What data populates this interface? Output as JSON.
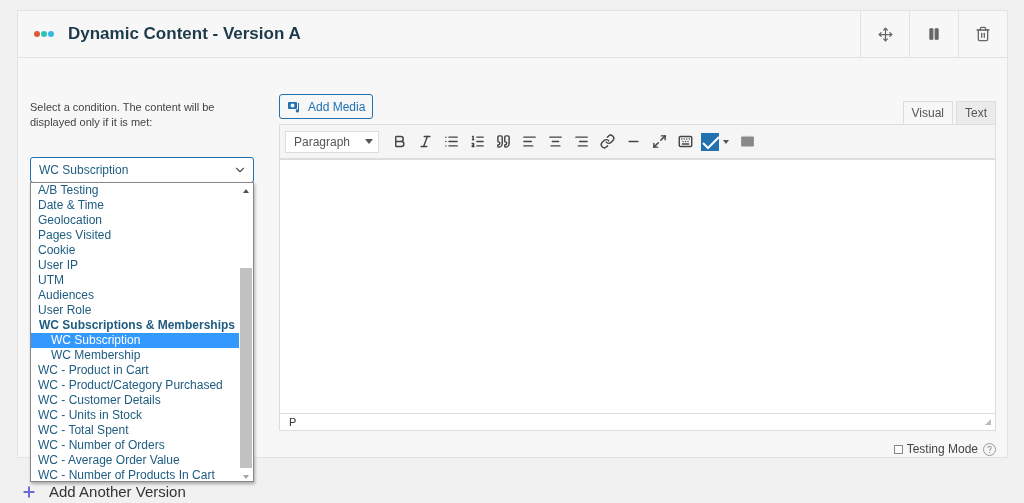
{
  "header": {
    "title": "Dynamic Content - Version A"
  },
  "condition": {
    "hint": "Select a condition. The content will be displayed only if it is met:",
    "value": "WC Subscription",
    "options": [
      {
        "label": "A/B Testing",
        "selected": false
      },
      {
        "label": "Date & Time",
        "selected": false
      },
      {
        "label": "Geolocation",
        "selected": false
      },
      {
        "label": "Pages Visited",
        "selected": false
      },
      {
        "label": "Cookie",
        "selected": false
      },
      {
        "label": "User IP",
        "selected": false
      },
      {
        "label": "UTM",
        "selected": false
      },
      {
        "label": "Audiences",
        "selected": false
      },
      {
        "label": "User Role",
        "selected": false
      },
      {
        "label": "WC Subscriptions & Memberships",
        "children": [
          {
            "label": "WC Subscription",
            "selected": true
          },
          {
            "label": "WC Membership",
            "selected": false
          }
        ]
      },
      {
        "label": "WC - Product in Cart",
        "selected": false
      },
      {
        "label": "WC - Product/Category Purchased",
        "selected": false
      },
      {
        "label": "WC - Customer Details",
        "selected": false
      },
      {
        "label": "WC - Units in Stock",
        "selected": false
      },
      {
        "label": "WC - Total Spent",
        "selected": false
      },
      {
        "label": "WC - Number of Orders",
        "selected": false
      },
      {
        "label": "WC - Average Order Value",
        "selected": false
      },
      {
        "label": "WC - Number of Products In Cart",
        "selected": false
      }
    ]
  },
  "editor": {
    "add_media": "Add Media",
    "tabs": [
      {
        "label": "Visual",
        "selected": true
      },
      {
        "label": "Text",
        "selected": false
      }
    ],
    "format": "Paragraph",
    "path": "P"
  },
  "testing_mode": {
    "label": "Testing Mode",
    "checked": false
  },
  "add_version": "Add Another Version"
}
